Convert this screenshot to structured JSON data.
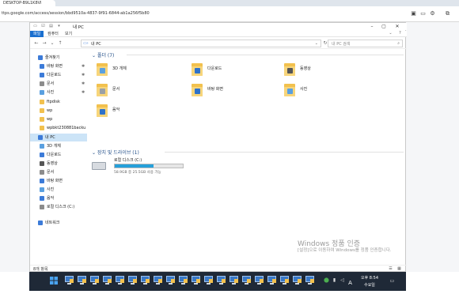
{
  "browser": {
    "tab_title": "DESKTOP-B9L1K8VI",
    "url": "ttps.google.com/access/session/bbd9510a-4837-9f91-6844-ab1a256f5b80"
  },
  "window": {
    "title": "내 PC",
    "ribbon_tabs": [
      {
        "label": "파일",
        "active": true
      },
      {
        "label": "컴퓨터",
        "active": false
      },
      {
        "label": "보기",
        "active": false
      }
    ],
    "address": "내 PC",
    "search_placeholder": "내 PC 검색"
  },
  "sidebar": {
    "items": [
      {
        "label": "즐겨찾기",
        "icon": "star-icon",
        "color": "#3c7bd8",
        "pinned": false,
        "selected": false
      },
      {
        "label": "바탕 화면",
        "icon": "desktop-icon",
        "color": "#3c7bd8",
        "pinned": true,
        "selected": false
      },
      {
        "label": "다운로드",
        "icon": "download-icon",
        "color": "#3c7bd8",
        "pinned": true,
        "selected": false
      },
      {
        "label": "문서",
        "icon": "document-icon",
        "color": "#8c8c8c",
        "pinned": true,
        "selected": false
      },
      {
        "label": "사진",
        "icon": "picture-icon",
        "color": "#5aa0e0",
        "pinned": true,
        "selected": false
      },
      {
        "label": "ftpdisk",
        "icon": "folder-icon",
        "color": "#f2c14e",
        "pinned": false,
        "selected": false
      },
      {
        "label": "wp",
        "icon": "folder-icon",
        "color": "#f2c14e",
        "pinned": false,
        "selected": false
      },
      {
        "label": "wp",
        "icon": "folder-icon",
        "color": "#f2c14e",
        "pinned": false,
        "selected": false
      },
      {
        "label": "wpbkt230881backu",
        "icon": "folder-icon",
        "color": "#f2c14e",
        "pinned": false,
        "selected": false
      },
      {
        "label": "내 PC",
        "icon": "pc-icon",
        "color": "#3c7bd8",
        "pinned": false,
        "selected": true
      },
      {
        "label": "3D 개체",
        "icon": "3d-objects-icon",
        "color": "#5aa0e0",
        "pinned": false,
        "selected": false
      },
      {
        "label": "다운로드",
        "icon": "download-icon",
        "color": "#3c7bd8",
        "pinned": false,
        "selected": false
      },
      {
        "label": "동영상",
        "icon": "video-icon",
        "color": "#555555",
        "pinned": false,
        "selected": false
      },
      {
        "label": "문서",
        "icon": "document-icon",
        "color": "#8c8c8c",
        "pinned": false,
        "selected": false
      },
      {
        "label": "바탕 화면",
        "icon": "desktop-icon",
        "color": "#3c7bd8",
        "pinned": false,
        "selected": false
      },
      {
        "label": "사진",
        "icon": "picture-icon",
        "color": "#5aa0e0",
        "pinned": false,
        "selected": false
      },
      {
        "label": "음악",
        "icon": "music-icon",
        "color": "#3c7bd8",
        "pinned": false,
        "selected": false
      },
      {
        "label": "로컬 디스크 (C:)",
        "icon": "drive-icon",
        "color": "#8c8c8c",
        "pinned": false,
        "selected": false
      },
      {
        "label": "네트워크",
        "icon": "network-icon",
        "color": "#3c7bd8",
        "pinned": false,
        "selected": false
      }
    ]
  },
  "content": {
    "folders_header": "폴더 (7)",
    "folders": [
      {
        "label": "3D 개체",
        "icon": "3d-objects-icon",
        "badge_color": "#5aa0e0"
      },
      {
        "label": "다운로드",
        "icon": "download-icon",
        "badge_color": "#2f72c9"
      },
      {
        "label": "동영상",
        "icon": "video-icon",
        "badge_color": "#555555"
      },
      {
        "label": "문서",
        "icon": "document-icon",
        "badge_color": "#9aa0a6"
      },
      {
        "label": "바탕 화면",
        "icon": "desktop-icon",
        "badge_color": "#2f72c9"
      },
      {
        "label": "사진",
        "icon": "picture-icon",
        "badge_color": "#5aa0e0"
      },
      {
        "label": "음악",
        "icon": "music-icon",
        "badge_color": "#2f72c9"
      }
    ],
    "drives_header": "장치 및 드라이브 (1)",
    "drive": {
      "name": "로컬 디스크 (C:)",
      "free_text": "58.9GB 중 25.5GB 사용 가능",
      "used_fraction": 0.57
    }
  },
  "status": {
    "item_count": "8개 항목"
  },
  "watermark": {
    "title": "Windows 정품 인증",
    "subtitle": "[설정]으로 이동하여 Windows를 정품 인증합니다."
  },
  "taskbar": {
    "time": "오후 8:54",
    "date": "수요일",
    "ime": "A"
  }
}
